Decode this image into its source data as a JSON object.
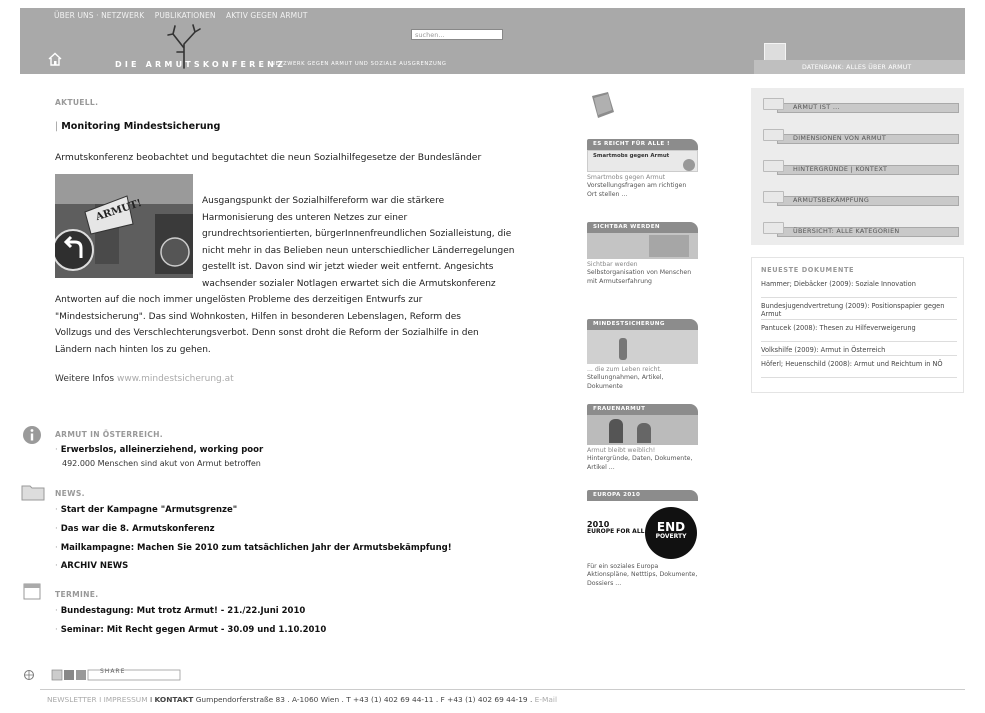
{
  "header": {
    "nav": [
      "ÜBER UNS · NETZWERK",
      "PUBLIKATIONEN",
      "AKTIV GEGEN ARMUT"
    ],
    "search_placeholder": "suchen...",
    "brand": "DIE ARMUTSKONFERENZ",
    "brand_sub": "NETZWERK GEGEN ARMUT UND SOZIALE AUSGRENZUNG",
    "database_label": "DATENBANK: ALLES ÜBER ARMUT"
  },
  "main": {
    "section_label": "AKTUELL.",
    "article_title": "Monitoring Mindestsicherung",
    "lead": "Armutskonferenz beobachtet und begutachtet die neun Sozialhilfegesetze der Bundesländer",
    "photo_sign": "ARMUT!",
    "body_lines_wrapped": [
      "Ausgangspunkt der Sozialhilfereform war die stärkere",
      "Harmonisierung des unteren Netzes zur einer",
      "grundrechtsorientierten, bürgerInnenfreundlichen Sozialleistung, die",
      "nicht mehr in das Belieben neun unterschiedlicher Länderregelungen",
      "gestellt ist. Davon sind wir jetzt wieder weit entfernt. Angesichts",
      "wachsender sozialer Notlagen erwartet sich die Armutskonferenz"
    ],
    "body_lines_full": [
      "Antworten auf die noch immer ungelösten Probleme des derzeitigen Entwurfs zur",
      "\"Mindestsicherung\". Das sind Wohnkosten, Hilfen in besonderen Lebenslagen, Reform des",
      "Vollzugs und des Verschlechterungsverbot. Denn sonst droht die Reform der Sozialhilfe in den",
      "Ländern nach hinten los zu gehen."
    ],
    "more_label": "Weitere Infos",
    "more_link": "www.mindestsicherung.at"
  },
  "armut": {
    "label": "ARMUT IN ÖSTERREICH.",
    "item": "Erwerbslos, alleinerziehend, working poor",
    "sub": "492.000 Menschen sind akut von Armut betroffen"
  },
  "news": {
    "label": "NEWS.",
    "items": [
      "Start der Kampagne \"Armutsgrenze\"",
      "Das war die 8. Armutskonferenz",
      "Mailkampagne: Machen Sie 2010 zum tatsächlichen Jahr der Armutsbekämpfung!",
      "ARCHIV NEWS"
    ]
  },
  "termine": {
    "label": "TERMINE.",
    "items": [
      "Bundestagung: Mut trotz Armut! - 21./22.Juni 2010",
      "Seminar: Mit Recht gegen Armut - 30.09 und 1.10.2010"
    ]
  },
  "share": {
    "label": "SHARE"
  },
  "footer": {
    "newsletter": "NEWSLETTER",
    "impressum": "IMPRESSUM",
    "kontakt": "KONTAKT",
    "address": "Gumpendorferstraße 83 . A-1060 Wien . T +43 (1) 402 69 44-11 . F +43 (1) 402 69 44-19 .",
    "email": "E-Mail"
  },
  "promos": [
    {
      "head": "ES REICHT FÜR ALLE !",
      "img_text": "Smartmobs gegen Armut",
      "cap_gray": "Smartmobs gegen Armut",
      "cap": "Vorstellungsfragen am richtigen Ort stellen ..."
    },
    {
      "head": "SICHTBAR WERDEN",
      "cap_gray": "Sichtbar werden",
      "cap": "Selbstorganisation von Menschen mit Armutserfahrung"
    },
    {
      "head": "MINDESTSICHERUNG",
      "cap_gray": "... die zum Leben reicht.",
      "cap": "Stellungnahmen, Artikel, Dokumente"
    },
    {
      "head": "FRAUENARMUT",
      "cap_gray": "Armut bleibt weiblich!",
      "cap": "Hintergründe, Daten, Dokumente, Artikel ..."
    },
    {
      "head": "EUROPA 2010",
      "logo_line1": "2010",
      "logo_line2": "EUROPE FOR ALL",
      "badge_top": "END",
      "badge_bottom": "POVERTY",
      "cap": "Für ein soziales Europa Aktionspläne, Netttips, Dokumente, Dossiers ..."
    }
  ],
  "categories": [
    "ARMUT IST ...",
    "DIMENSIONEN VON ARMUT",
    "HINTERGRÜNDE | KONTEXT",
    "ARMUTSBEKÄMPFUNG",
    "ÜBERSICHT: ALLE KATEGORIEN"
  ],
  "documents": {
    "title": "NEUESTE DOKUMENTE",
    "items": [
      "Hammer; Diebäcker (2009): Soziale Innovation",
      "Bundesjugendvertretung (2009): Positionspapier gegen Armut",
      "Pantucek (2008): Thesen zu Hilfeverweigerung",
      "Volkshilfe (2009): Armut in Österreich",
      "Höferl; Heuenschild (2008): Armut und Reichtum in NÖ"
    ]
  }
}
